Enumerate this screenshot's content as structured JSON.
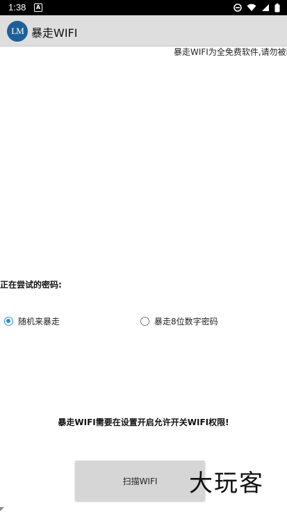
{
  "status_bar": {
    "time": "1:38",
    "notification_icon": "a-notification-icon"
  },
  "app_bar": {
    "logo_text": "LM",
    "title": "暴走WIFI"
  },
  "marquee_text": "暴走WIFI为全免费软件,请勿被骗",
  "trying_label": "正在尝试的密码:",
  "radio_options": [
    {
      "label": "随机来暴走",
      "checked": true
    },
    {
      "label": "暴走8位数字密码",
      "checked": false
    }
  ],
  "notice_text": "暴走WIFI需要在设置开启允许开关WIFI权限!",
  "scan_button_label": "扫描WIFI",
  "watermark_text": "大玩客",
  "colors": {
    "accent": "#2b8ec9",
    "app_bar": "#dedede",
    "logo": "#1d5f99"
  }
}
